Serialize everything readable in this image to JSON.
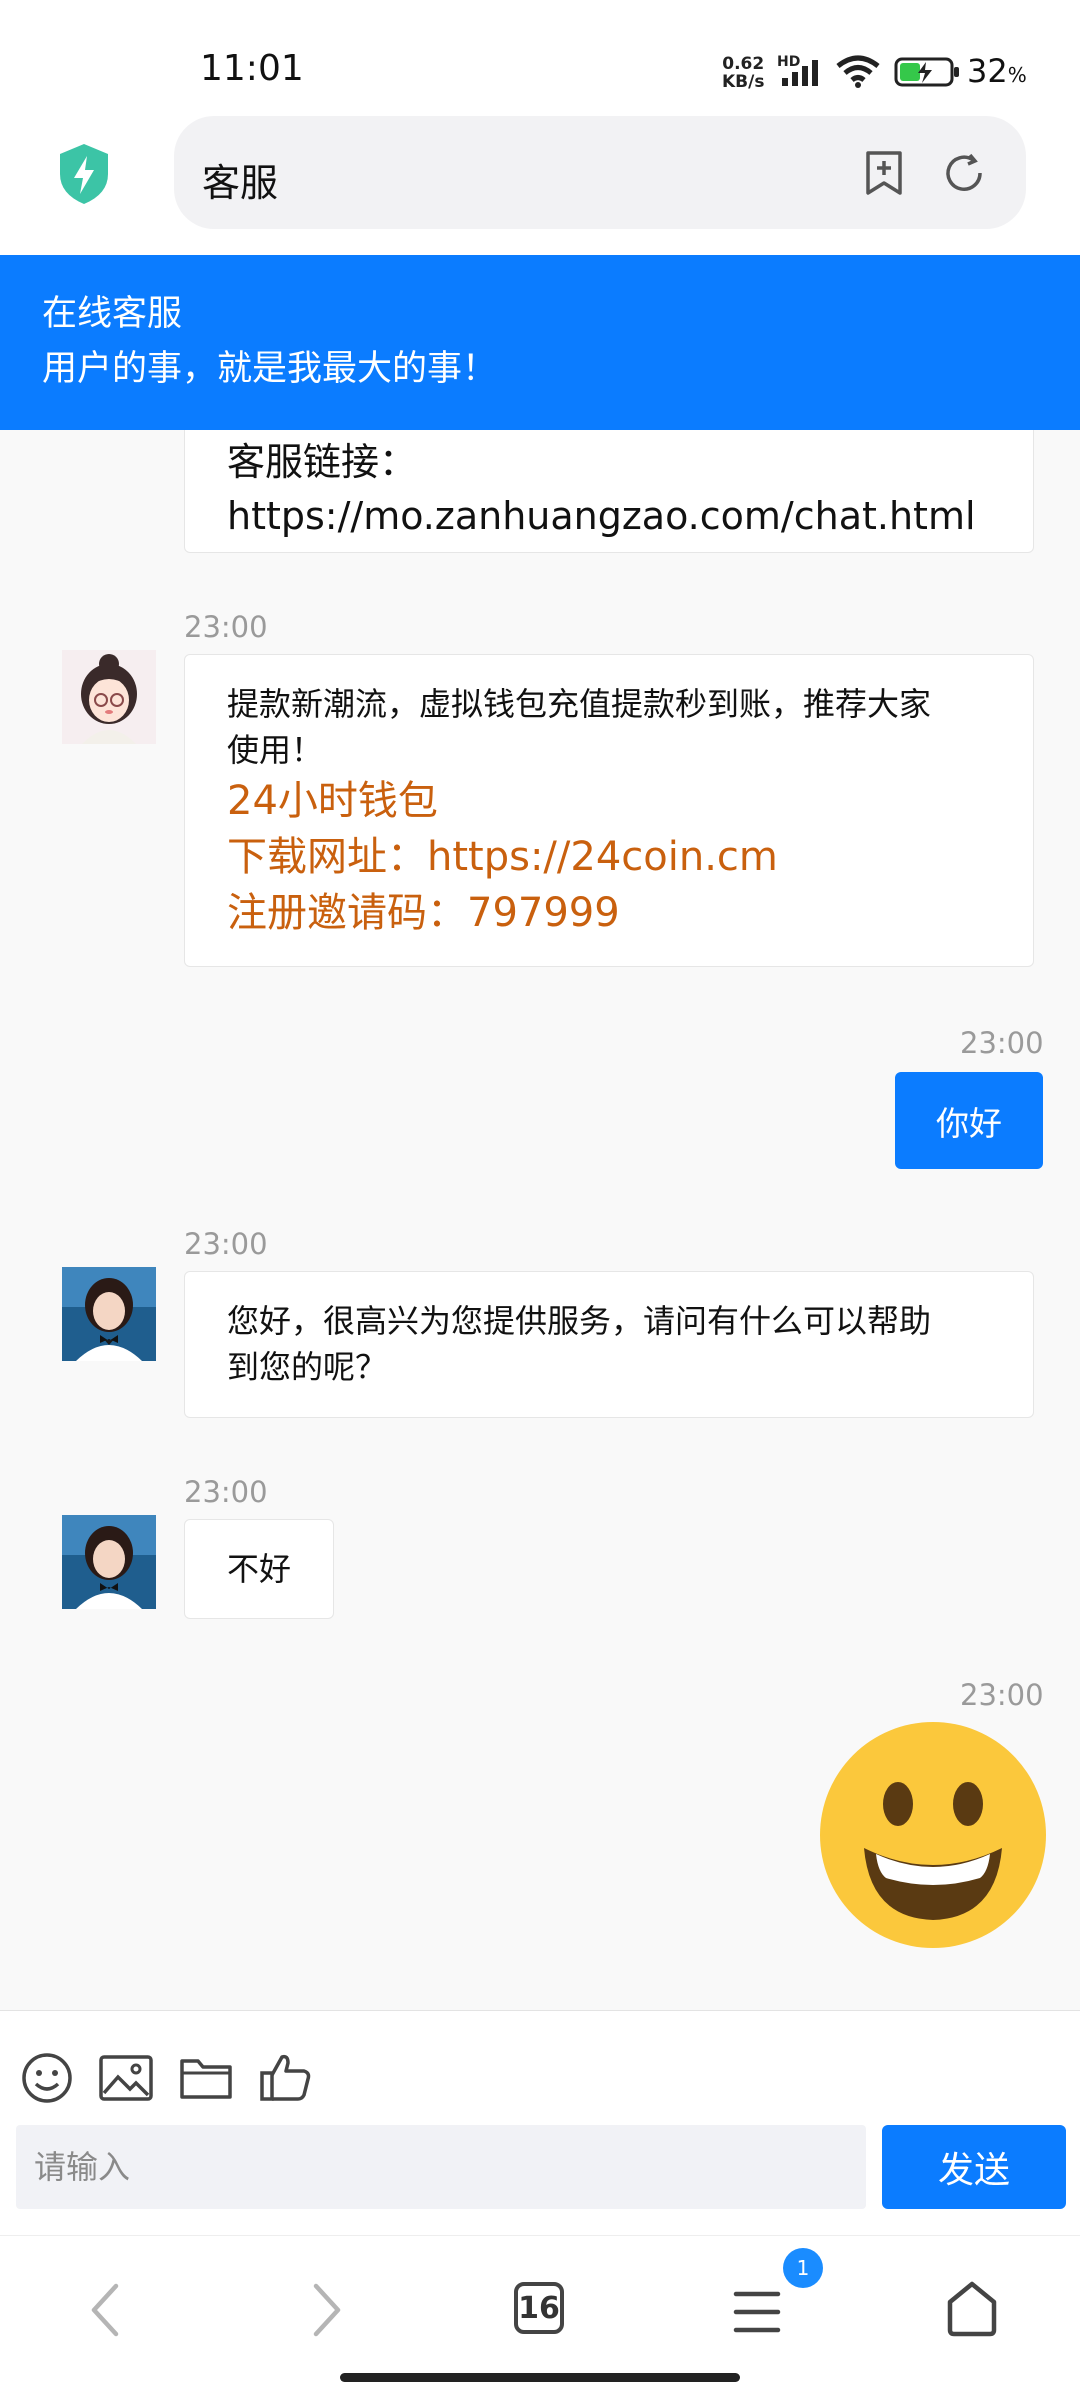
{
  "status_bar": {
    "time": "11:01",
    "net_speed_value": "0.62",
    "net_speed_unit": "KB/s",
    "network_badge": "HD",
    "battery_percent": "32",
    "battery_unit": "%"
  },
  "browser": {
    "address_text": "客服"
  },
  "service_header": {
    "title": "在线客服",
    "slogan": "用户的事，就是我最大的事！"
  },
  "chat": {
    "messages": [
      {
        "side": "received",
        "lines": [
          "客服链接：",
          "https://mo.zanhuangzao.com/chat.html"
        ]
      },
      {
        "side": "received",
        "timestamp": "23:00",
        "avatar": "cartoon-girl-avatar",
        "text_lines": [
          "提款新潮流，虚拟钱包充值提款秒到账，推荐大家",
          "使用！"
        ],
        "promo_lines": [
          "24小时钱包",
          "下载网址：https://24coin.cm",
          "注册邀请码：797999"
        ]
      },
      {
        "side": "sent",
        "timestamp": "23:00",
        "text": "你好"
      },
      {
        "side": "received",
        "timestamp": "23:00",
        "avatar": "agent-avatar",
        "text_lines": [
          "您好，很高兴为您提供服务，请问有什么可以帮助",
          "到您的呢？"
        ]
      },
      {
        "side": "received",
        "timestamp": "23:00",
        "avatar": "agent-avatar",
        "text": "不好"
      },
      {
        "side": "sent",
        "timestamp": "23:00",
        "emoji": "grinning-face-emoji"
      }
    ]
  },
  "composer": {
    "tools": [
      "emoji-icon",
      "image-icon",
      "folder-icon",
      "thumbs-up-icon"
    ],
    "placeholder": "请输入",
    "send_label": "发送"
  },
  "bottom_nav": {
    "tab_count": "16",
    "menu_badge": "1"
  },
  "colors": {
    "accent": "#0b7cff",
    "promo": "#c9600e",
    "emoji_face": "#fbc83c"
  }
}
